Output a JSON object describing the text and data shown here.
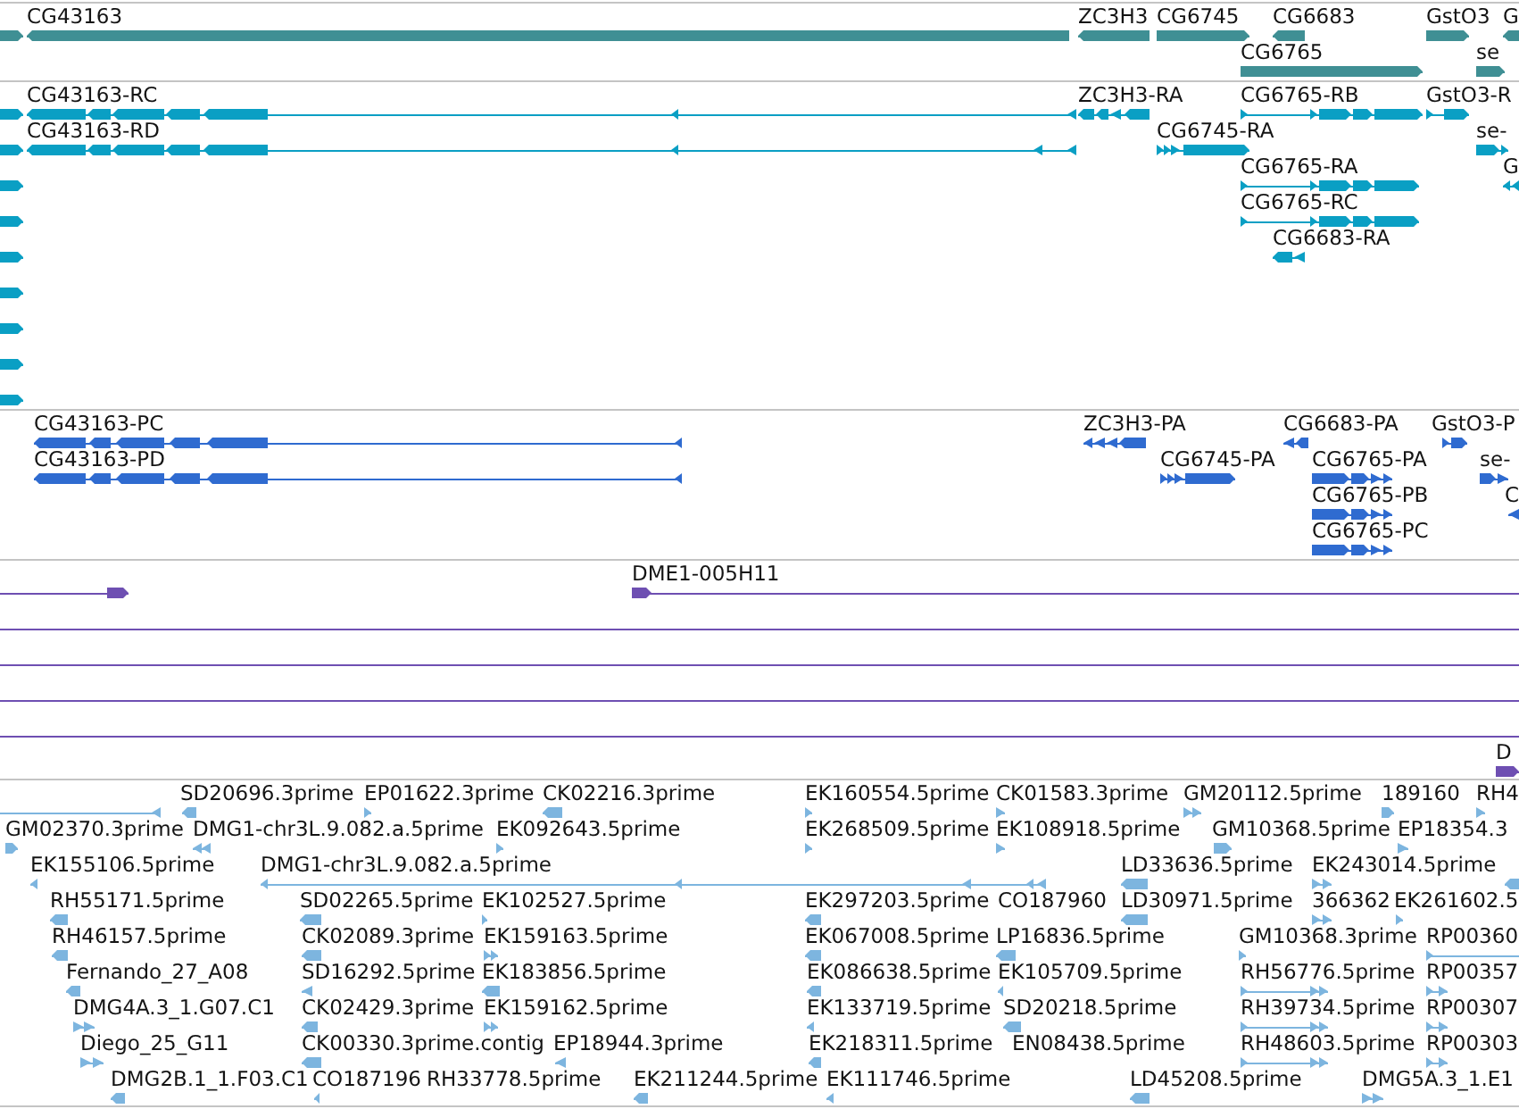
{
  "tracks": [
    {
      "kind": "gene",
      "features": [
        {
          "reverse": false
        },
        {
          "label": "CG43163",
          "reverse": true
        },
        {
          "label": "ZC3H3",
          "reverse": true
        },
        {
          "label": "CG6745",
          "reverse": false
        },
        {
          "label": "CG6683",
          "reverse": true
        },
        {
          "label": "GstO3",
          "reverse": false
        },
        {
          "label": "G",
          "reverse": true
        },
        {
          "label": "CG6765",
          "reverse": false
        },
        {
          "label": "se",
          "reverse": false
        }
      ]
    },
    {
      "kind": "transcript",
      "features": [
        {
          "reverse": false
        },
        {
          "label": "CG43163-RC",
          "reverse": true
        },
        {
          "label": "ZC3H3-RA",
          "reverse": true
        },
        {
          "label": "CG6765-RB",
          "reverse": false
        },
        {
          "label": "GstO3-R",
          "reverse": false
        },
        {
          "reverse": false
        },
        {
          "label": "CG43163-RD",
          "reverse": true
        },
        {
          "label": "CG6745-RA",
          "reverse": false
        },
        {
          "label": "se-",
          "reverse": false
        },
        {
          "reverse": false
        },
        {
          "label": "CG6765-RA",
          "reverse": false
        },
        {
          "label": "G",
          "reverse": true
        },
        {
          "reverse": false
        },
        {
          "label": "CG6765-RC",
          "reverse": false
        },
        {
          "reverse": false
        },
        {
          "label": "CG6683-RA",
          "reverse": true
        },
        {
          "reverse": false
        },
        {
          "reverse": false
        },
        {
          "reverse": false
        },
        {
          "reverse": false
        }
      ]
    },
    {
      "kind": "cds",
      "features": [
        {
          "label": "CG43163-PC",
          "reverse": true
        },
        {
          "label": "ZC3H3-PA",
          "reverse": true
        },
        {
          "label": "CG6683-PA",
          "reverse": true
        },
        {
          "label": "GstO3-P",
          "reverse": false
        },
        {
          "label": "CG43163-PD",
          "reverse": true
        },
        {
          "label": "CG6745-PA",
          "reverse": false
        },
        {
          "label": "CG6765-PA",
          "reverse": false
        },
        {
          "label": "se-",
          "reverse": false
        },
        {
          "label": "CG6765-PB",
          "reverse": false
        },
        {
          "label": "C",
          "reverse": true
        },
        {
          "label": "CG6765-PC",
          "reverse": false
        }
      ]
    },
    {
      "kind": "clone",
      "features": [
        {
          "kind": "arrow",
          "reverse": false
        },
        {
          "label": "DME1-005H11",
          "kind": "arrow",
          "reverse": false
        },
        {
          "kind": "line"
        },
        {
          "kind": "line"
        },
        {
          "kind": "line"
        },
        {
          "kind": "line"
        },
        {
          "label": "D",
          "kind": "arrow",
          "reverse": false
        }
      ]
    },
    {
      "kind": "est",
      "features": [
        {
          "reverse": true
        },
        {
          "label": "SD20696.3prime",
          "reverse": true
        },
        {
          "label": "EP01622.3prime",
          "reverse": false
        },
        {
          "label": "CK02216.3prime",
          "reverse": true
        },
        {
          "label": "EK160554.5prime",
          "reverse": false
        },
        {
          "label": "CK01583.3prime",
          "reverse": false
        },
        {
          "label": "GM20112.5prime",
          "reverse": false
        },
        {
          "label": "189160",
          "reverse": false
        },
        {
          "label": "RH4",
          "reverse": false
        },
        {
          "label": "GM02370.3prime",
          "reverse": false
        },
        {
          "label": "DMG1-chr3L.9.082.a.5prime",
          "reverse": true
        },
        {
          "label": "EK092643.5prime",
          "reverse": false
        },
        {
          "label": "EK268509.5prime",
          "reverse": false
        },
        {
          "label": "EK108918.5prime",
          "reverse": false
        },
        {
          "label": "GM10368.5prime",
          "reverse": false
        },
        {
          "label": "EP18354.3",
          "reverse": false
        },
        {
          "label": "EK155106.5prime",
          "reverse": true
        },
        {
          "label": "DMG1-chr3L.9.082.a.5prime",
          "reverse": true
        },
        {
          "label": "LD33636.5prime",
          "reverse": true
        },
        {
          "label": "EK243014.5prime",
          "reverse": false
        },
        {
          "reverse": true
        },
        {
          "label": "RH55171.5prime",
          "reverse": true
        },
        {
          "label": "SD02265.5prime",
          "reverse": true
        },
        {
          "label": "EK102527.5prime",
          "reverse": false
        },
        {
          "label": "EK297203.5prime",
          "reverse": true
        },
        {
          "label": "CO187960"
        },
        {
          "label": "LD30971.5prime",
          "reverse": true
        },
        {
          "label": "366362",
          "reverse": false
        },
        {
          "label": "EK261602.5",
          "reverse": false
        },
        {
          "label": "RH46157.5prime",
          "reverse": true
        },
        {
          "label": "CK02089.3prime",
          "reverse": true
        },
        {
          "label": "EK159163.5prime",
          "reverse": false
        },
        {
          "label": "EK067008.5prime",
          "reverse": true
        },
        {
          "label": "LP16836.5prime",
          "reverse": true
        },
        {
          "label": "GM10368.3prime",
          "reverse": false
        },
        {
          "label": "RP00360",
          "reverse": false
        },
        {
          "label": "Fernando_27_A08",
          "reverse": true
        },
        {
          "label": "SD16292.5prime",
          "reverse": true
        },
        {
          "label": "EK183856.5prime",
          "reverse": true
        },
        {
          "label": "EK086638.5prime",
          "reverse": true
        },
        {
          "label": "EK105709.5prime",
          "reverse": true
        },
        {
          "label": "RH56776.5prime",
          "reverse": false
        },
        {
          "label": "RP00357",
          "reverse": false
        },
        {
          "label": "DMG4A.3_1.G07.C1",
          "reverse": false
        },
        {
          "label": "CK02429.3prime",
          "reverse": true
        },
        {
          "label": "EK159162.5prime",
          "reverse": false
        },
        {
          "label": "EK133719.5prime",
          "reverse": true
        },
        {
          "label": "SD20218.5prime",
          "reverse": true
        },
        {
          "label": "RH39734.5prime",
          "reverse": false
        },
        {
          "label": "RP00307",
          "reverse": false
        },
        {
          "label": "Diego_25_G11",
          "reverse": false
        },
        {
          "label": "CK00330.3prime.contig",
          "reverse": true
        },
        {
          "label": "EP18944.3prime",
          "reverse": true
        },
        {
          "label": "EK218311.5prime",
          "reverse": true
        },
        {
          "label": "EN08438.5prime"
        },
        {
          "label": "RH48603.5prime",
          "reverse": false
        },
        {
          "label": "RP00303",
          "reverse": false
        },
        {
          "label": "DMG2B.1_1.F03.C1",
          "reverse": true
        },
        {
          "label": "CO187196",
          "reverse": true
        },
        {
          "label": "RH33778.5prime"
        },
        {
          "label": "EK211244.5prime",
          "reverse": true
        },
        {
          "label": "EK111746.5prime",
          "reverse": true
        },
        {
          "label": "LD45208.5prime",
          "reverse": true
        },
        {
          "label": "DMG5A.3_1.E1",
          "reverse": false
        }
      ]
    }
  ]
}
